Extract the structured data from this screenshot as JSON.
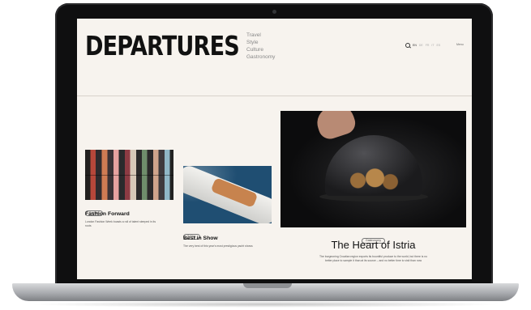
{
  "site": {
    "logo": "DEPARTURES",
    "nav": [
      "Travel",
      "Style",
      "Culture",
      "Gastronomy"
    ],
    "languages": [
      "EN",
      "DE",
      "FR",
      "IT",
      "ES"
    ],
    "account_label": "Menu"
  },
  "articles": [
    {
      "tag": "Fashion",
      "title": "Fashion Forward",
      "desc": "London Fashion Week boasts a roll of talent steeped in its roots"
    },
    {
      "tag": "Sailing",
      "title": "Best in Show",
      "desc": "The very best of this year's most prestigious yacht shows"
    }
  ],
  "feature": {
    "tag": "Gastronomy",
    "title": "The Heart of Istria",
    "desc_line1": "The burgeoning Croatian region exports its bountiful produce to the world, but there is no",
    "desc_line2": "better place to sample it than at its source – and no better time to visit than now"
  },
  "colors": {
    "screen_bg": "#f7f3ee",
    "frame": "#0f0f10",
    "text": "#111111"
  }
}
